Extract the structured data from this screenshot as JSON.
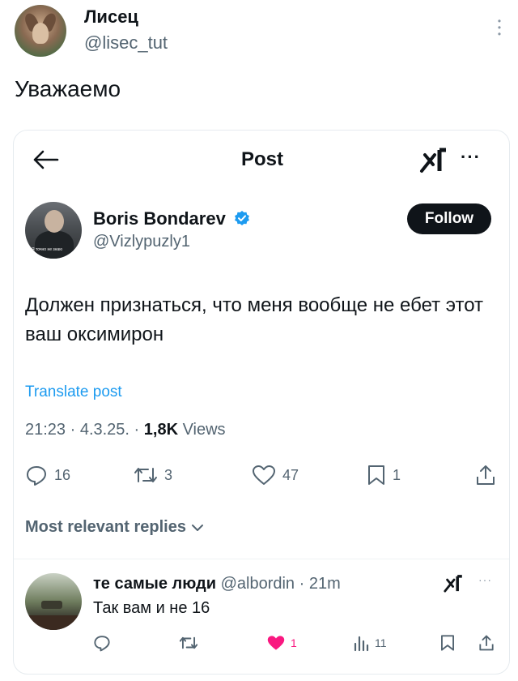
{
  "outer": {
    "display_name": "Лисец",
    "handle": "@lisec_tut",
    "text": "Уважаемо"
  },
  "card": {
    "title": "Post",
    "more": "···",
    "author": {
      "name": "Boris Bondarev",
      "handle": "@Vizlypuzly1",
      "verified": true
    },
    "follow_label": "Follow",
    "body": "Должен признаться, что меня вообще не ебет этот ваш оксимирон",
    "translate_label": "Translate post",
    "meta": {
      "time_date": "21:23 · 4.3.25. · ",
      "views_count": "1,8K",
      "views_label": " Views"
    },
    "actions": {
      "replies": "16",
      "reposts": "3",
      "likes": "47",
      "bookmarks": "1"
    },
    "replies_sort_label": "Most relevant replies",
    "reply": {
      "name": "те самые люди",
      "meta": " @albordin · 21m",
      "text": "Так вам и не 16",
      "likes": "1",
      "views": "11",
      "more": "···"
    }
  },
  "colors": {
    "accent": "#1d9bf0",
    "like_active": "#f91880",
    "secondary_text": "#536471",
    "follow_bg": "#0f1419"
  }
}
